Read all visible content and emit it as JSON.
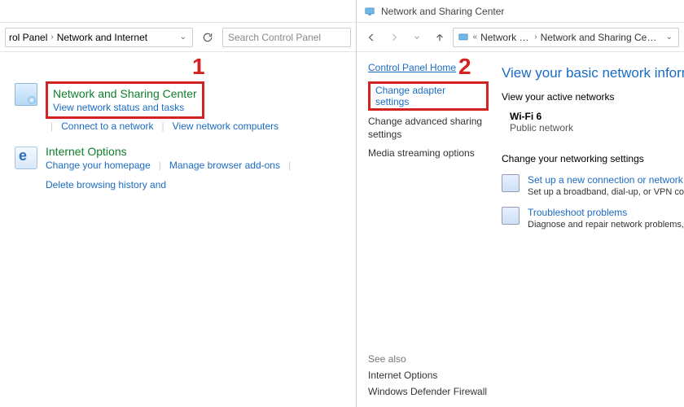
{
  "annotation": {
    "num1": "1",
    "num2": "2"
  },
  "left": {
    "breadcrumb": {
      "crumb1": "rol Panel",
      "crumb2": "Network and Internet"
    },
    "search_placeholder": "Search Control Panel",
    "item1": {
      "title": "Network and Sharing Center",
      "link1": "View network status and tasks",
      "link2": "Connect to a network",
      "link3": "View network computers"
    },
    "item2": {
      "title": "Internet Options",
      "link1": "Change your homepage",
      "link2": "Manage browser add-ons",
      "link3": "Delete browsing history and"
    }
  },
  "right": {
    "title": "Network and Sharing Center",
    "breadcrumb": {
      "crumb1": "Network a...",
      "crumb2": "Network and Sharing Center",
      "ellipsis": "«"
    },
    "cp_home": "Control Panel Home",
    "side": {
      "change_adapter": "Change adapter settings",
      "change_adv": "Change advanced sharing settings",
      "media": "Media streaming options"
    },
    "see_also_hdr": "See also",
    "see_also1": "Internet Options",
    "see_also2": "Windows Defender Firewall",
    "main": {
      "heading": "View your basic network information and",
      "active_hdr": "View your active networks",
      "net_name": "Wi-Fi 6",
      "net_type": "Public network",
      "change_hdr": "Change your networking settings",
      "task1": {
        "title": "Set up a new connection or network",
        "desc": "Set up a broadband, dial-up, or VPN conne"
      },
      "task2": {
        "title": "Troubleshoot problems",
        "desc": "Diagnose and repair network problems, or g"
      }
    }
  }
}
